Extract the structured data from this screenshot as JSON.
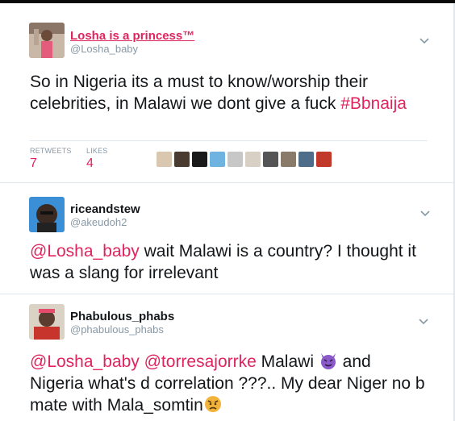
{
  "tweet1": {
    "name": "Losha is a princess™",
    "handle": "@Losha_baby",
    "text": "So in Nigeria its a must to know/worship their celebrities,  in Malawi we dont give a fuck",
    "hashtag": "#Bbnaija",
    "retweets_label": "RETWEETS",
    "retweets": "7",
    "likes_label": "LIKES",
    "likes": "4",
    "liker_colors": [
      "#d9c7b0",
      "#4a3b30",
      "#1a1a1a",
      "#6fb3e0",
      "#c7c7c7",
      "#d8d0c4",
      "#555555",
      "#8a7a6a",
      "#4d6d8a",
      "#c0392b"
    ]
  },
  "reply1": {
    "name": "riceandstew",
    "handle": "@akeudoh2",
    "mention": "@Losha_baby",
    "text": " wait Malawi is a country? I thought it was a slang for irrelevant"
  },
  "reply2": {
    "name": "Phabulous_phabs",
    "handle": "@phabulous_phabs",
    "mention1": "@Losha_baby",
    "mention2": "@torresajorrke",
    "text_a": "  Malawi ",
    "text_b": " and Nigeria what's d correlation ???.. My dear Niger no b mate with Mala_somtin",
    "emoji1": "purple-devil-icon",
    "emoji2": "angry-face-icon"
  },
  "colors": {
    "accent": "#e0245e",
    "muted": "#8899a6",
    "divider": "#e1e8ed"
  }
}
